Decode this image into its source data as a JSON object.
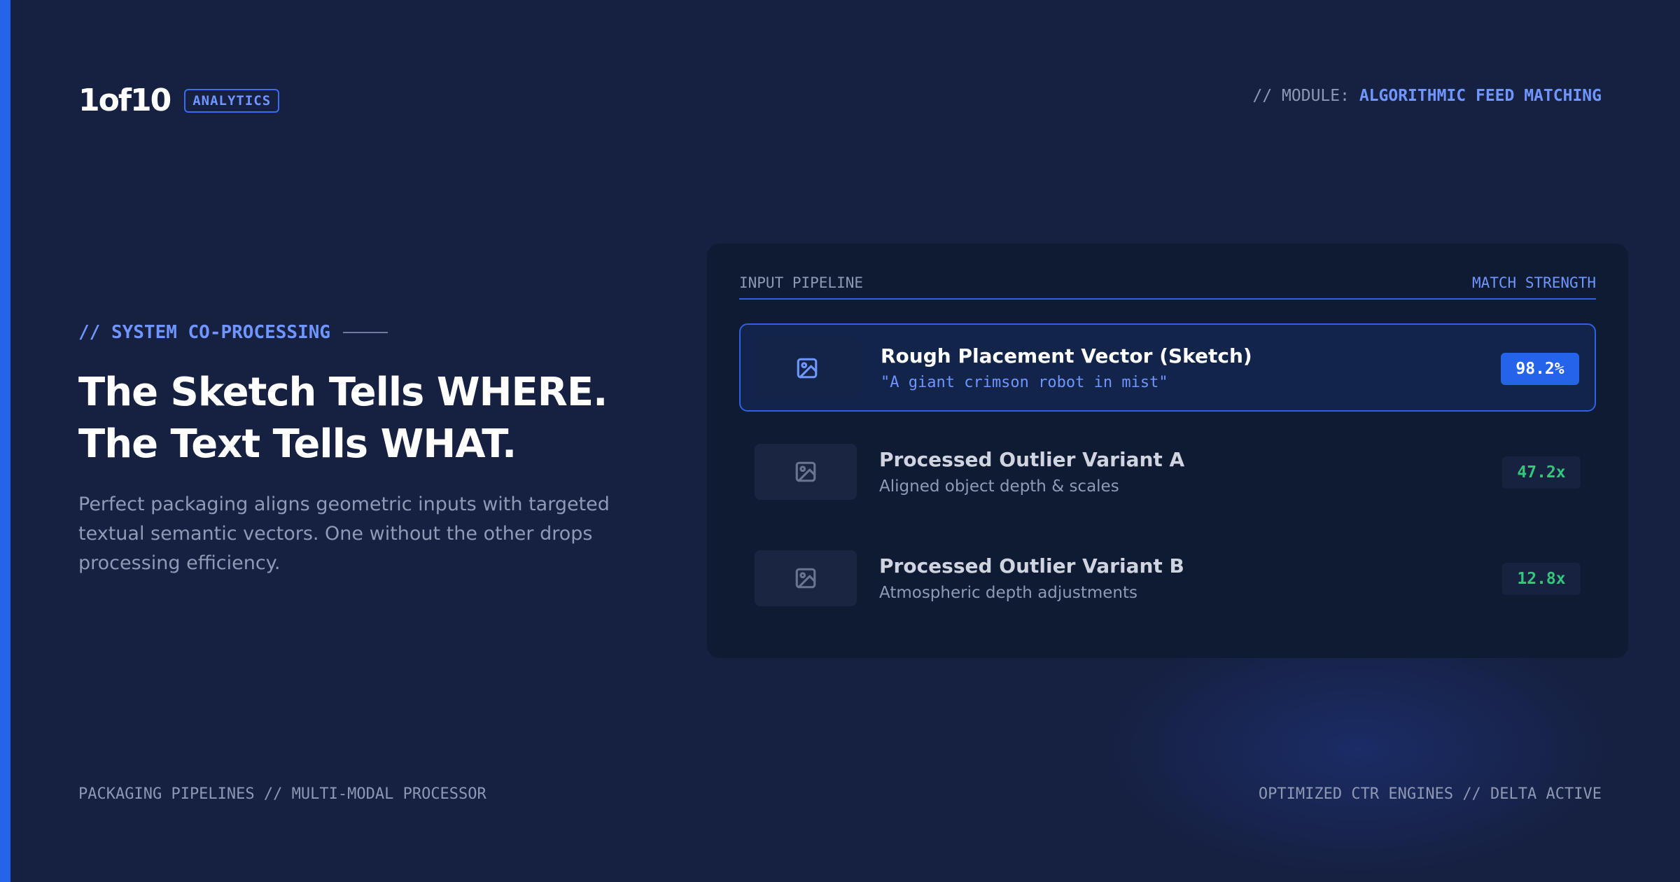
{
  "header": {
    "logo": "1of10",
    "badge": "ANALYTICS",
    "module_prefix": "// MODULE: ",
    "module_value": "ALGORITHMIC FEED MATCHING"
  },
  "hero": {
    "eyebrow": "// SYSTEM CO-PROCESSING",
    "headline_line1": "The Sketch Tells WHERE.",
    "headline_line2": "The Text Tells WHAT.",
    "description": "Perfect packaging aligns geometric inputs with targeted textual semantic vectors. One without the other drops processing efficiency."
  },
  "panel": {
    "left_header": "INPUT PIPELINE",
    "right_header": "MATCH STRENGTH",
    "rows": [
      {
        "title": "Rough Placement Vector (Sketch)",
        "subtitle": "\"A giant crimson robot in mist\"",
        "score": "98.2%",
        "icon": "image-icon"
      },
      {
        "title": "Processed Outlier Variant A",
        "subtitle": "Aligned object depth & scales",
        "score": "47.2x",
        "icon": "image-icon"
      },
      {
        "title": "Processed Outlier Variant B",
        "subtitle": "Atmospheric depth adjustments",
        "score": "12.8x",
        "icon": "image-icon"
      }
    ]
  },
  "footer": {
    "left": "PACKAGING PIPELINES // MULTI-MODAL PROCESSOR",
    "right": "OPTIMIZED CTR ENGINES // DELTA ACTIVE"
  },
  "colors": {
    "background": "#162041",
    "accent": "#2563eb",
    "accent_text": "#6f95ff",
    "panel": "#0f1a33",
    "positive": "#34c77b"
  }
}
